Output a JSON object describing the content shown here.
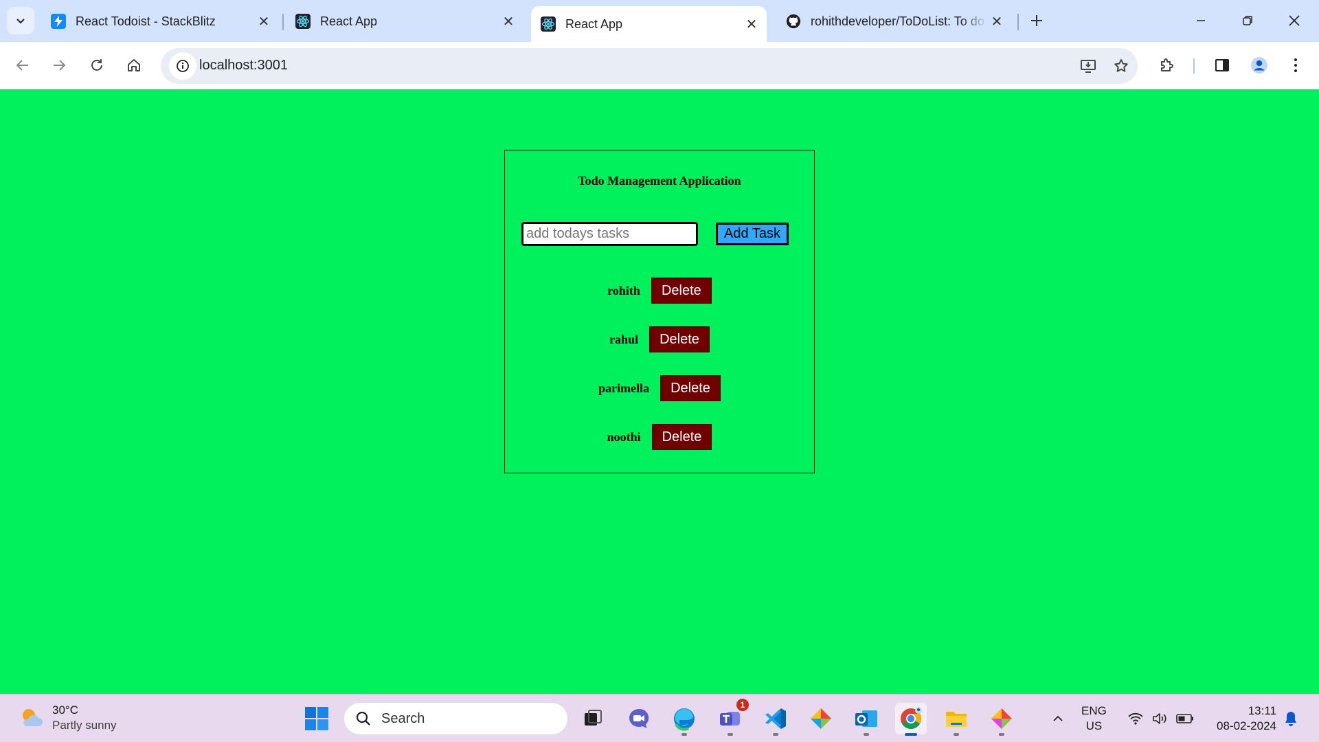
{
  "browser": {
    "tabs": [
      {
        "title": "React Todoist - StackBlitz",
        "favicon": "stackblitz-icon",
        "active": false
      },
      {
        "title": "React App",
        "favicon": "react-icon",
        "active": false
      },
      {
        "title": "React App",
        "favicon": "react-icon",
        "active": true
      },
      {
        "title": "rohithdeveloper/ToDoList: To do",
        "favicon": "github-icon",
        "active": false
      }
    ],
    "url": "localhost:3001"
  },
  "app": {
    "title": "Todo Management Application",
    "input_placeholder": "add todays tasks",
    "input_value": "",
    "add_label": "Add Task",
    "delete_label": "Delete",
    "tasks": [
      "rohith",
      "rahul",
      "parimella",
      "noothi"
    ]
  },
  "taskbar": {
    "weather_temp": "30°C",
    "weather_desc": "Partly sunny",
    "search_label": "Search",
    "teams_badge": "1",
    "lang_line1": "ENG",
    "lang_line2": "US",
    "time": "13:11",
    "date": "08-02-2024"
  },
  "colors": {
    "page_background": "#00f15b",
    "add_button": "#2fa8ff",
    "delete_button": "#700000"
  }
}
